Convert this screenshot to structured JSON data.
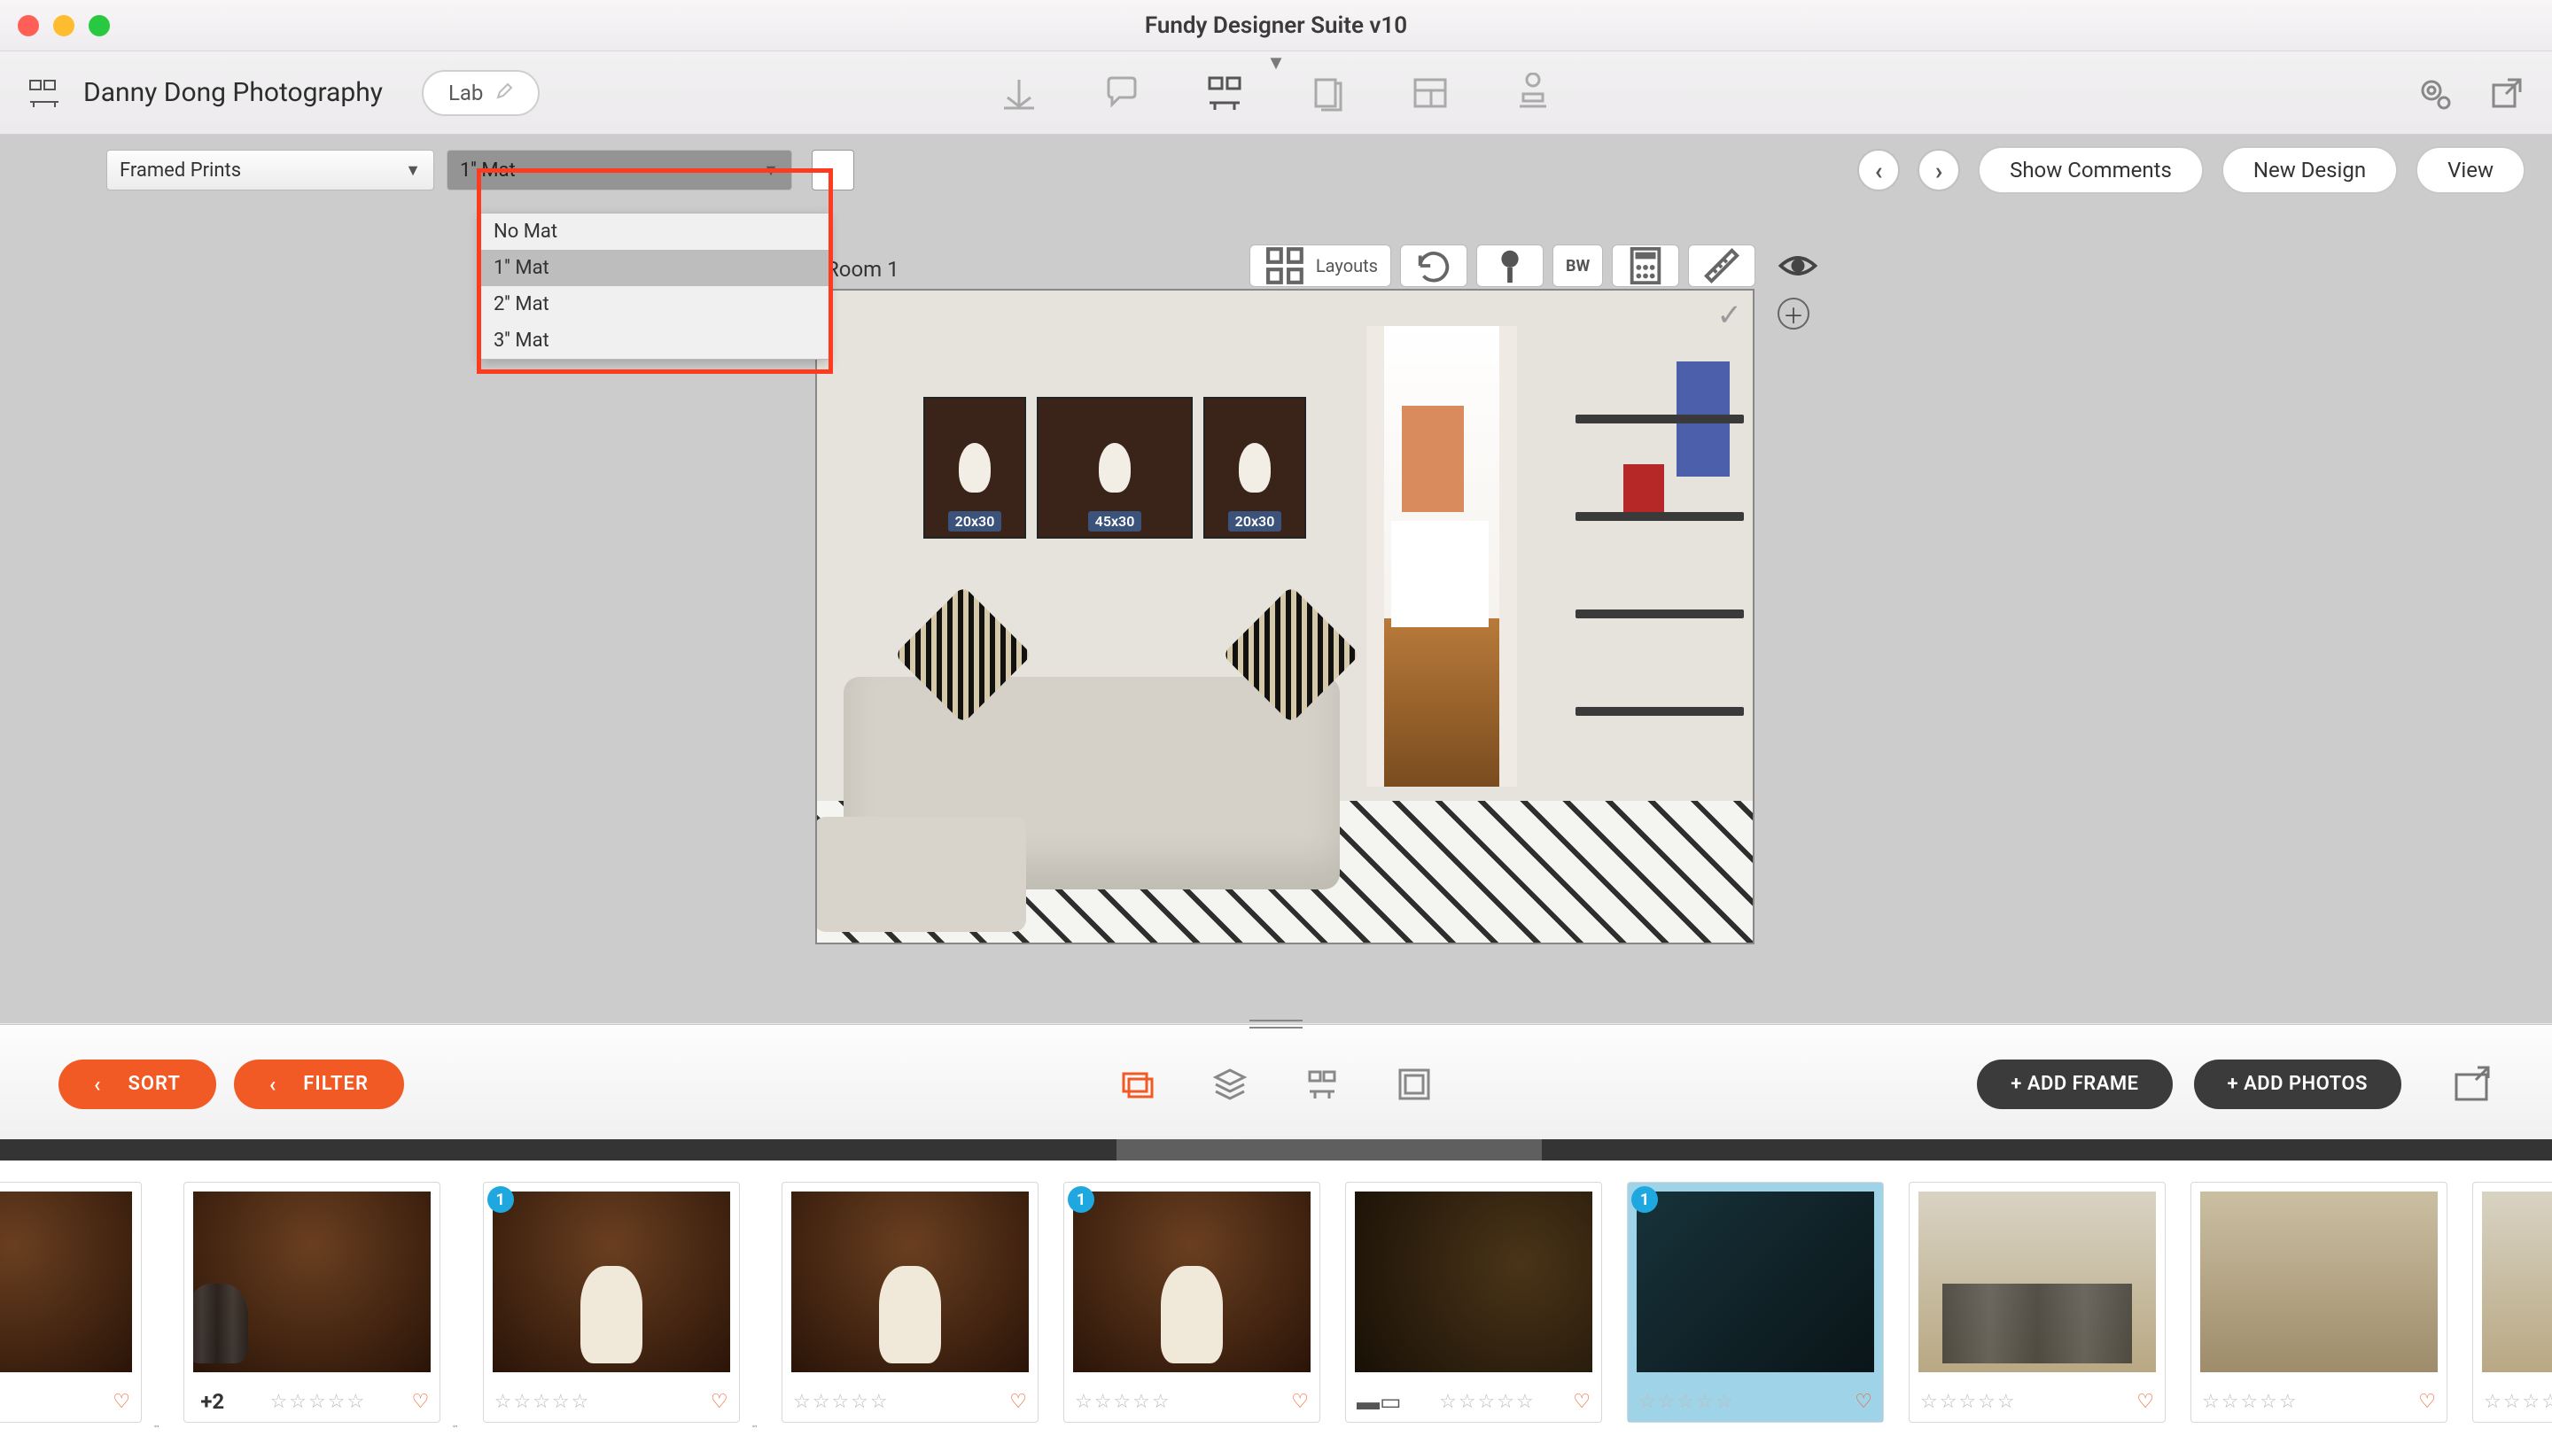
{
  "window": {
    "title": "Fundy Designer Suite v10"
  },
  "project": {
    "name": "Danny Dong Photography",
    "lab_label": "Lab"
  },
  "top_icons": {
    "import": "import",
    "chat": "chat",
    "wall": "wall-designer",
    "cards": "cards",
    "layout": "layout",
    "stamp": "stamp",
    "gear": "settings",
    "external": "external"
  },
  "secbar": {
    "product_dropdown": "Framed Prints",
    "mat_dropdown_selected": "1'' Mat",
    "mat_options": [
      "No Mat",
      "1'' Mat",
      "2'' Mat",
      "3'' Mat"
    ],
    "buttons": {
      "show_comments": "Show Comments",
      "new_design": "New Design",
      "view": "View"
    }
  },
  "canvas": {
    "room_label": "Room 1",
    "layouts_label": "Layouts",
    "bw_label": "BW",
    "prints": [
      {
        "dim": "20x30",
        "w": 116,
        "h": 160
      },
      {
        "dim": "45x30",
        "w": 176,
        "h": 160
      },
      {
        "dim": "20x30",
        "w": 116,
        "h": 160
      }
    ]
  },
  "strip": {
    "sort": "SORT",
    "filter": "FILTER",
    "add_frame": "+ ADD FRAME",
    "add_photos": "+ ADD PHOTOS"
  },
  "thumbs": [
    {
      "kind": "group",
      "link_after": true
    },
    {
      "kind": "group",
      "plus": "+2",
      "link_after": true
    },
    {
      "kind": "church",
      "badge": "1",
      "link_after": true
    },
    {
      "kind": "church"
    },
    {
      "kind": "church",
      "badge": "1"
    },
    {
      "kind": "stairs",
      "album": true
    },
    {
      "kind": "dark",
      "badge": "1",
      "selected": true
    },
    {
      "kind": "outdoor"
    },
    {
      "kind": "veil"
    },
    {
      "kind": "outdoor"
    }
  ]
}
